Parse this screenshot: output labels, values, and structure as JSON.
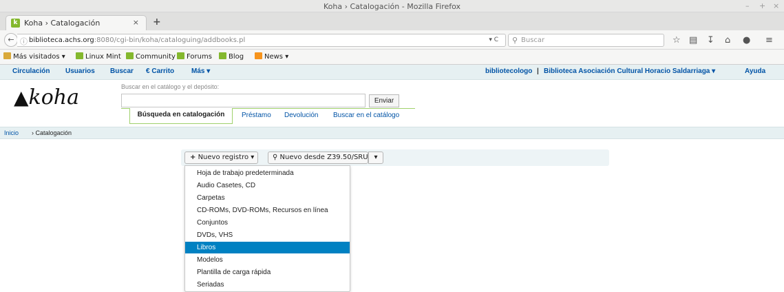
{
  "window": {
    "title": "Koha › Catalogación - Mozilla Firefox",
    "controls": [
      "–",
      "+",
      "×"
    ]
  },
  "tab": {
    "label": "Koha › Catalogación",
    "close": "×",
    "newtab": "+"
  },
  "nav": {
    "url_host": "biblioteca.achs.org",
    "url_path": ":8080/cgi-bin/koha/cataloguing/addbooks.pl",
    "search_placeholder": "Buscar",
    "reload_dd": "▾ C"
  },
  "bookmarks": [
    {
      "label": "Más visitados ▾",
      "icon": "folder-icon"
    },
    {
      "label": "Linux Mint",
      "icon": "mint-icon"
    },
    {
      "label": "Community",
      "icon": "mint-icon"
    },
    {
      "label": "Forums",
      "icon": "mint-icon"
    },
    {
      "label": "Blog",
      "icon": "mint-icon"
    },
    {
      "label": "News ▾",
      "icon": "rss-icon"
    }
  ],
  "koha": {
    "menu": [
      "Circulación",
      "Usuarios",
      "Buscar",
      "Carrito",
      "Más"
    ],
    "user": "bibliotecologo",
    "separator": "|",
    "library": "Biblioteca Asociación Cultural Horacio Saldarriaga",
    "help": "Ayuda",
    "logo": "koha",
    "search_label": "Buscar en el catálogo y el depósito:",
    "search_value": "",
    "submit": "Enviar",
    "tabs": [
      "Búsqueda en catalogación",
      "Préstamo",
      "Devolución",
      "Buscar en el catálogo"
    ]
  },
  "breadcrumbs": {
    "home": "Inicio",
    "current": "› Catalogación"
  },
  "toolbar": {
    "new_record": "Nuevo registro",
    "new_from_z3950": "Nuevo desde Z39.50/SRU"
  },
  "dropdown": {
    "items": [
      "Hoja de trabajo predeterminada",
      "Audio Casetes, CD",
      "Carpetas",
      "CD-ROMs, DVD-ROMs, Recursos en línea",
      "Conjuntos",
      "DVDs, VHS",
      "Libros",
      "Modelos",
      "Plantilla de carga rápida",
      "Seriadas"
    ],
    "selected": "Libros"
  },
  "colors": {
    "link": "#0053a6",
    "highlight": "#0081c2",
    "green": "#9fd16b"
  }
}
